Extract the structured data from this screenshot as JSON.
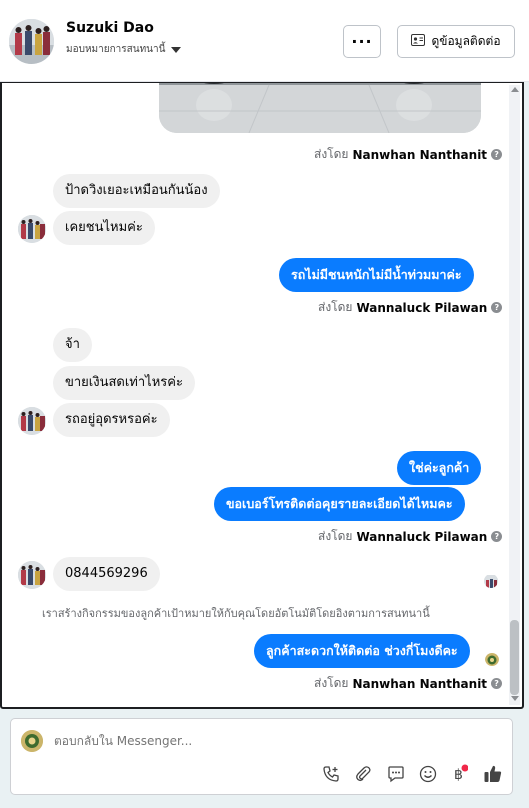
{
  "header": {
    "name": "Suzuki Dao",
    "subtitle": "มอบหมายการสนทนานี้",
    "more_label": "···",
    "contact_label": "ดูข้อมูลติดต่อ"
  },
  "messages": {
    "sent_prefix": "ส่งโดย",
    "sender_a": "Nanwhan Nanthanit",
    "sender_b": "Wannaluck Pilawan",
    "sender_c": "Wannaluck Pilawan",
    "sender_d": "Nanwhan Nanthanit",
    "m1": "ป้าดวิงเยอะเหมือนกันน้อง",
    "m2": "เคยชนไหมค่ะ",
    "m3": "รถไม่มีชนหนักไม่มีน้ำท่วมมาค่ะ",
    "m4": "จ้า",
    "m5": "ขายเงินสดเท่าไหรค่ะ",
    "m6": "รถอยู่อุดรหรอค่ะ",
    "m7": "ใช่ค่ะลูกค้า",
    "m8": "ขอเบอร์โทรติดต่อคุยรายละเอียดได้ไหมคะ",
    "m9": "0844569296",
    "notice": "เราสร้างกิจกรรมของลูกค้าเป้าหมายให้กับคุณโดยอัตโนมัติโดยอิงตามการสนทนานี้",
    "m10": "ลูกค้าสะดวกให้ติดต่อ ช่วงกี่โมงดีคะ"
  },
  "composer": {
    "placeholder": "ตอบกลับใน Messenger..."
  },
  "icons": [
    "chevron-down-icon",
    "contact-card-icon",
    "question-icon",
    "phone-add-icon",
    "attach-icon",
    "saved-reply-icon",
    "emoji-icon",
    "baht-icon",
    "thumbs-up-icon"
  ],
  "colors": {
    "outgoing": "#0a7cff",
    "incoming": "#f0f0f0",
    "notification_dot": "#f02849"
  }
}
